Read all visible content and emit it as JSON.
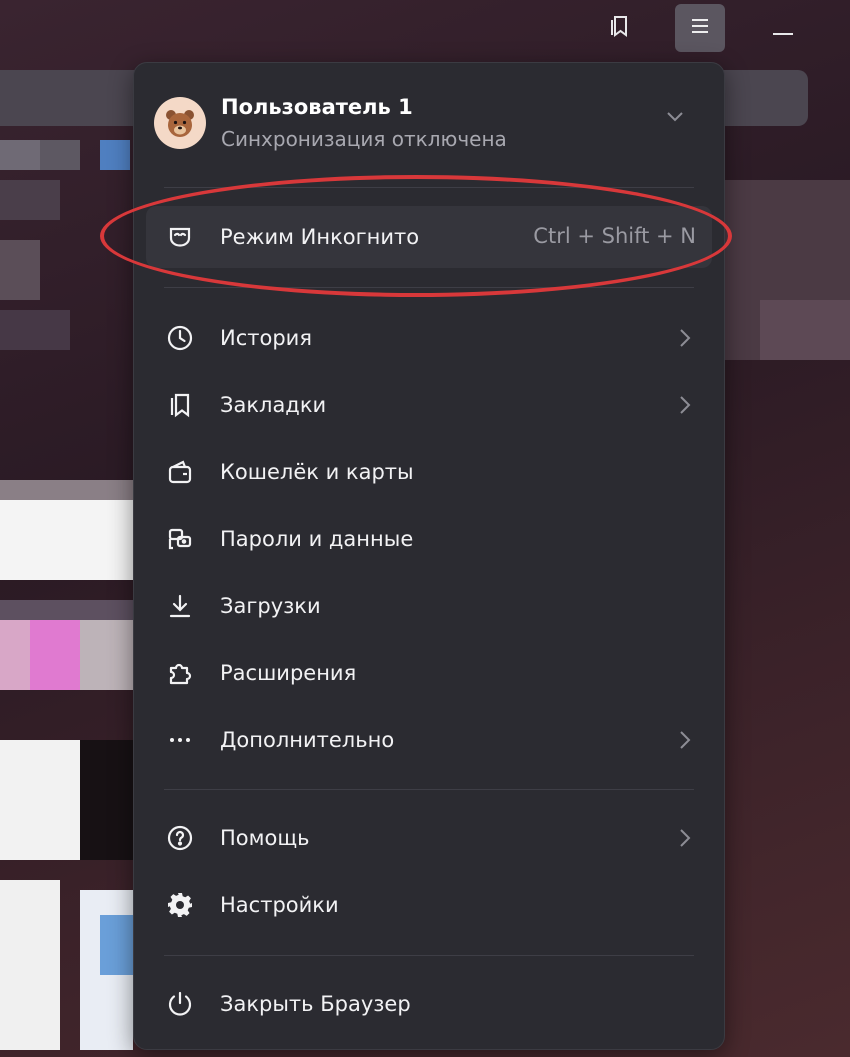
{
  "profile": {
    "name": "Пользователь 1",
    "sync_status": "Синхронизация отключена",
    "avatar_icon": "bear-avatar-icon"
  },
  "incognito": {
    "label": "Режим Инкогнито",
    "shortcut": "Ctrl + Shift + N",
    "icon": "incognito-mask-icon"
  },
  "menu_items": [
    {
      "label": "История",
      "icon": "clock-icon",
      "submenu": true
    },
    {
      "label": "Закладки",
      "icon": "bookmark-icon",
      "submenu": true
    },
    {
      "label": "Кошелёк и карты",
      "icon": "wallet-icon",
      "submenu": false
    },
    {
      "label": "Пароли и данные",
      "icon": "key-icon",
      "submenu": false
    },
    {
      "label": "Загрузки",
      "icon": "download-icon",
      "submenu": false
    },
    {
      "label": "Расширения",
      "icon": "puzzle-icon",
      "submenu": false
    },
    {
      "label": "Дополнительно",
      "icon": "more-icon",
      "submenu": true
    }
  ],
  "help_items": [
    {
      "label": "Помощь",
      "icon": "question-icon",
      "submenu": true
    },
    {
      "label": "Настройки",
      "icon": "gear-icon",
      "submenu": false
    }
  ],
  "close_item": {
    "label": "Закрыть Браузер",
    "icon": "power-icon"
  },
  "colors": {
    "menu_bg": "#2b2b31",
    "highlight_ring": "#d8383a",
    "text": "#f2f2f4",
    "muted": "#a8a8b0"
  }
}
